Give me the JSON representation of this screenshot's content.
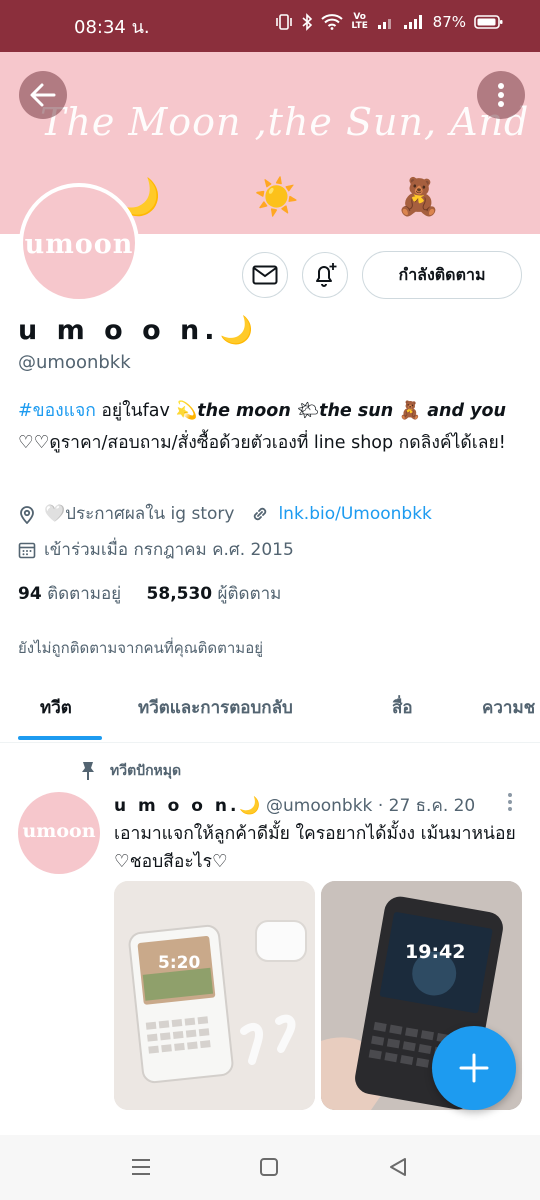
{
  "status_bar": {
    "time": "08:34 น.",
    "battery": "87%",
    "volte": "Vo LTE"
  },
  "banner": {
    "title": "The Moon ,the Sun, And You",
    "emojis": [
      "🌙",
      "☀️",
      "🧸"
    ],
    "color": "#f6c7cc"
  },
  "avatar": {
    "text": "umoon"
  },
  "actions": {
    "follow_label": "กำลังติดตาม"
  },
  "profile": {
    "name": "u m o o n.",
    "name_emoji": "🌙",
    "handle": "@umoonbkk",
    "bio": {
      "hashtag": "#ของแจก",
      "text1": " อยู่ในfav ",
      "emoji1": "💫",
      "part2": "the moon ",
      "emoji2": "🌤",
      "part3": "the sun ",
      "emoji3": "🧸",
      "part4": " and you",
      "line2": "♡♡ดูราคา/สอบถาม/สั่งซื้อด้วยตัวเองที่ line shop กดลิงค์ได้เลย!"
    },
    "location": "🤍ประกาศผลใน ig story",
    "link": "lnk.bio/Umoonbkk",
    "joined": "เข้าร่วมเมื่อ กรกฎาคม ค.ศ. 2015",
    "following_count": "94",
    "following_label": "ติดตามอยู่",
    "followers_count": "58,530",
    "followers_label": "ผู้ติดตาม",
    "not_followed": "ยังไม่ถูกติดตามจากคนที่คุณติดตามอยู่"
  },
  "tabs": [
    {
      "label": "ทวีต",
      "active": true
    },
    {
      "label": "ทวีตและการตอบกลับ"
    },
    {
      "label": "สื่อ"
    },
    {
      "label": "ความช"
    }
  ],
  "tweet": {
    "pinned_label": "ทวีตปักหมุด",
    "avatar_text": "umoon",
    "name": "u m o o n.",
    "name_emoji": "🌙",
    "handle": "@umoonbkk",
    "separator": "·",
    "date": "27 ธ.ค. 20",
    "text": "เอามาแจกให้ลูกค้าดีมั้ย ใครอยากได้มั้งง เม้นมาหน่อย ♡ชอบสีอะไร♡",
    "image1_time": "5:20",
    "image2_time": "19:42"
  },
  "colors": {
    "accent": "#1d9bf0",
    "status_bar": "#8b2f3c",
    "pink": "#f6c7cc"
  },
  "icons": [
    "back-arrow-icon",
    "more-vertical-icon",
    "mail-icon",
    "bell-plus-icon",
    "location-icon",
    "link-icon",
    "calendar-icon",
    "pin-icon",
    "compose-plus-icon"
  ]
}
